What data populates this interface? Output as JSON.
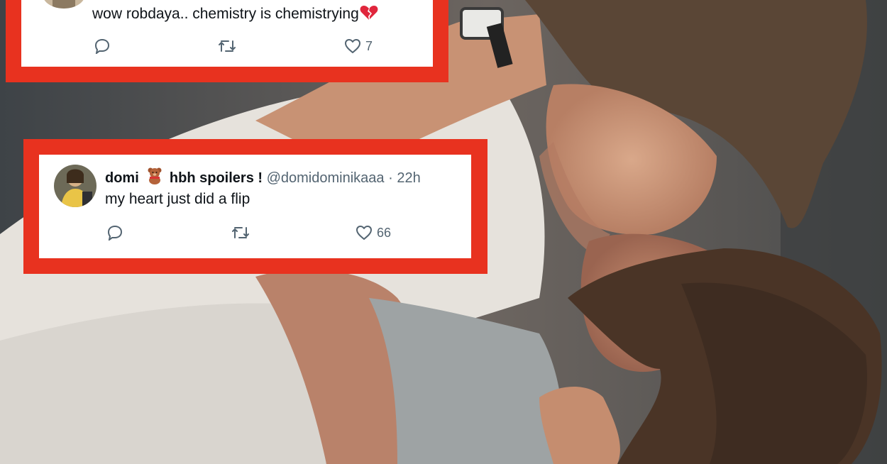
{
  "photo": {
    "subject": "couple embracing",
    "dominant_tone": "warm skin, white shirt, dark hair"
  },
  "tweets": [
    {
      "text": "wow robdaya.. chemistry is chemistrying",
      "emoji_icon": "broken-heart-icon",
      "actions": {
        "reply_icon": "reply-icon",
        "retweet_icon": "retweet-icon",
        "like_icon": "heart-outline-icon",
        "like_count": "7"
      }
    },
    {
      "display_name_1": "domi",
      "emoji_icon": "teddy-bear-icon",
      "display_name_2": "hbh spoilers !",
      "handle": "@domidominikaaa",
      "separator": "·",
      "time": "22h",
      "text": "my heart just did a flip",
      "actions": {
        "reply_icon": "reply-icon",
        "retweet_icon": "retweet-icon",
        "like_icon": "heart-outline-icon",
        "like_count": "66"
      }
    }
  ],
  "colors": {
    "frame_red": "#e8321f",
    "card_white": "#ffffff",
    "text_primary": "#0f1419",
    "text_secondary": "#536471"
  }
}
